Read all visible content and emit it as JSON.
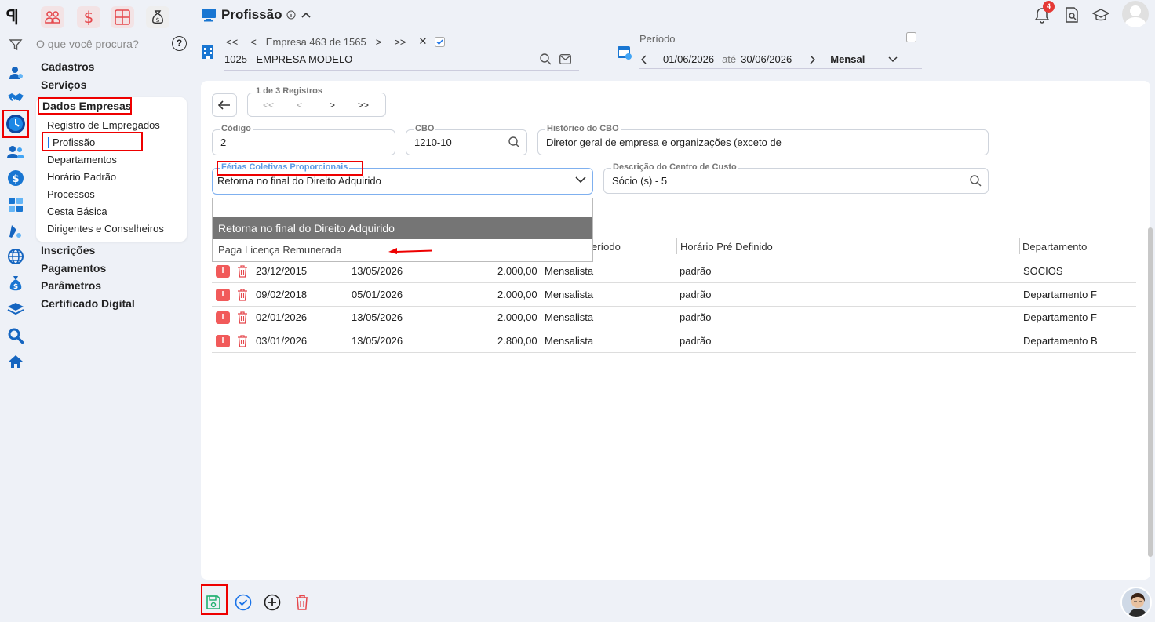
{
  "app": {
    "logo": "ꟼ|"
  },
  "rail": {
    "icons": [
      "filter-icon",
      "user-icon",
      "handshake-icon",
      "clock-icon",
      "users-icon",
      "dollar-icon",
      "calculator-icon",
      "pen-icon",
      "globe-icon",
      "money-bag-icon",
      "layers-icon",
      "search-icon",
      "home-icon"
    ]
  },
  "sidebar": {
    "search_placeholder": "O que você procura?",
    "help": "?",
    "sections": {
      "cadastros": "Cadastros",
      "servicos": "Serviços",
      "dados_empresas": "Dados Empresas",
      "inscricoes": "Inscrições",
      "pagamentos": "Pagamentos",
      "parametros": "Parâmetros",
      "certificado": "Certificado Digital"
    },
    "sub_items": [
      "Registro de Empregados",
      "Profissão",
      "Departamentos",
      "Horário Padrão",
      "Processos",
      "Cesta Básica",
      "Dirigentes e Conselheiros"
    ]
  },
  "header": {
    "title": "Profissão",
    "emp_label": "Empresa 463 de 1565",
    "nav": {
      "first": "<<",
      "prev": "<",
      "next": ">",
      "last": ">>",
      "close": "✕"
    },
    "emp_name": "1025 - EMPRESA MODELO",
    "period_label": "Período",
    "period_start": "01/06/2026",
    "period_until": "até",
    "period_end": "30/06/2026",
    "period_type": "Mensal",
    "notification_count": "4"
  },
  "records": {
    "label": "1 de 3 Registros",
    "first": "<<",
    "prev": "<",
    "next": ">",
    "last": ">>"
  },
  "form": {
    "codigo_label": "Código",
    "codigo_value": "2",
    "cbo_label": "CBO",
    "cbo_value": "1210-10",
    "historico_label": "Histórico do CBO",
    "historico_value": "Diretor geral de empresa e organizações (exceto de",
    "ferias_label": "Férias Coletivas Proporcionais",
    "ferias_value": "Retorna no final do Direito Adquirido",
    "centro_label": "Descrição do Centro de Custo",
    "centro_value": "Sócio (s) - 5"
  },
  "dropdown": {
    "options": [
      "",
      "Retorna no final do Direito Adquirido",
      "Paga Licença Remunerada"
    ]
  },
  "table": {
    "headers": {
      "periodo": "eríodo",
      "horario": "Horário Pré Definido",
      "departamento": "Departamento"
    },
    "badge": "I",
    "rows": [
      {
        "inicio": "23/12/2015",
        "fim": "13/05/2026",
        "valor": "2.000,00",
        "periodo": "Mensalista",
        "horario": "padrão",
        "departamento": "SOCIOS"
      },
      {
        "inicio": "09/02/2018",
        "fim": "05/01/2026",
        "valor": "2.000,00",
        "periodo": "Mensalista",
        "horario": "padrão",
        "departamento": "Departamento F"
      },
      {
        "inicio": "02/01/2026",
        "fim": "13/05/2026",
        "valor": "2.000,00",
        "periodo": "Mensalista",
        "horario": "padrão",
        "departamento": "Departamento F"
      },
      {
        "inicio": "03/01/2026",
        "fim": "13/05/2026",
        "valor": "2.800,00",
        "periodo": "Mensalista",
        "horario": "padrão",
        "departamento": "Departamento B"
      }
    ]
  },
  "colors": {
    "accent": "#1a73e8",
    "brand_red": "#e5484d",
    "highlight_red": "#e00000",
    "selected_option": "#757575"
  }
}
